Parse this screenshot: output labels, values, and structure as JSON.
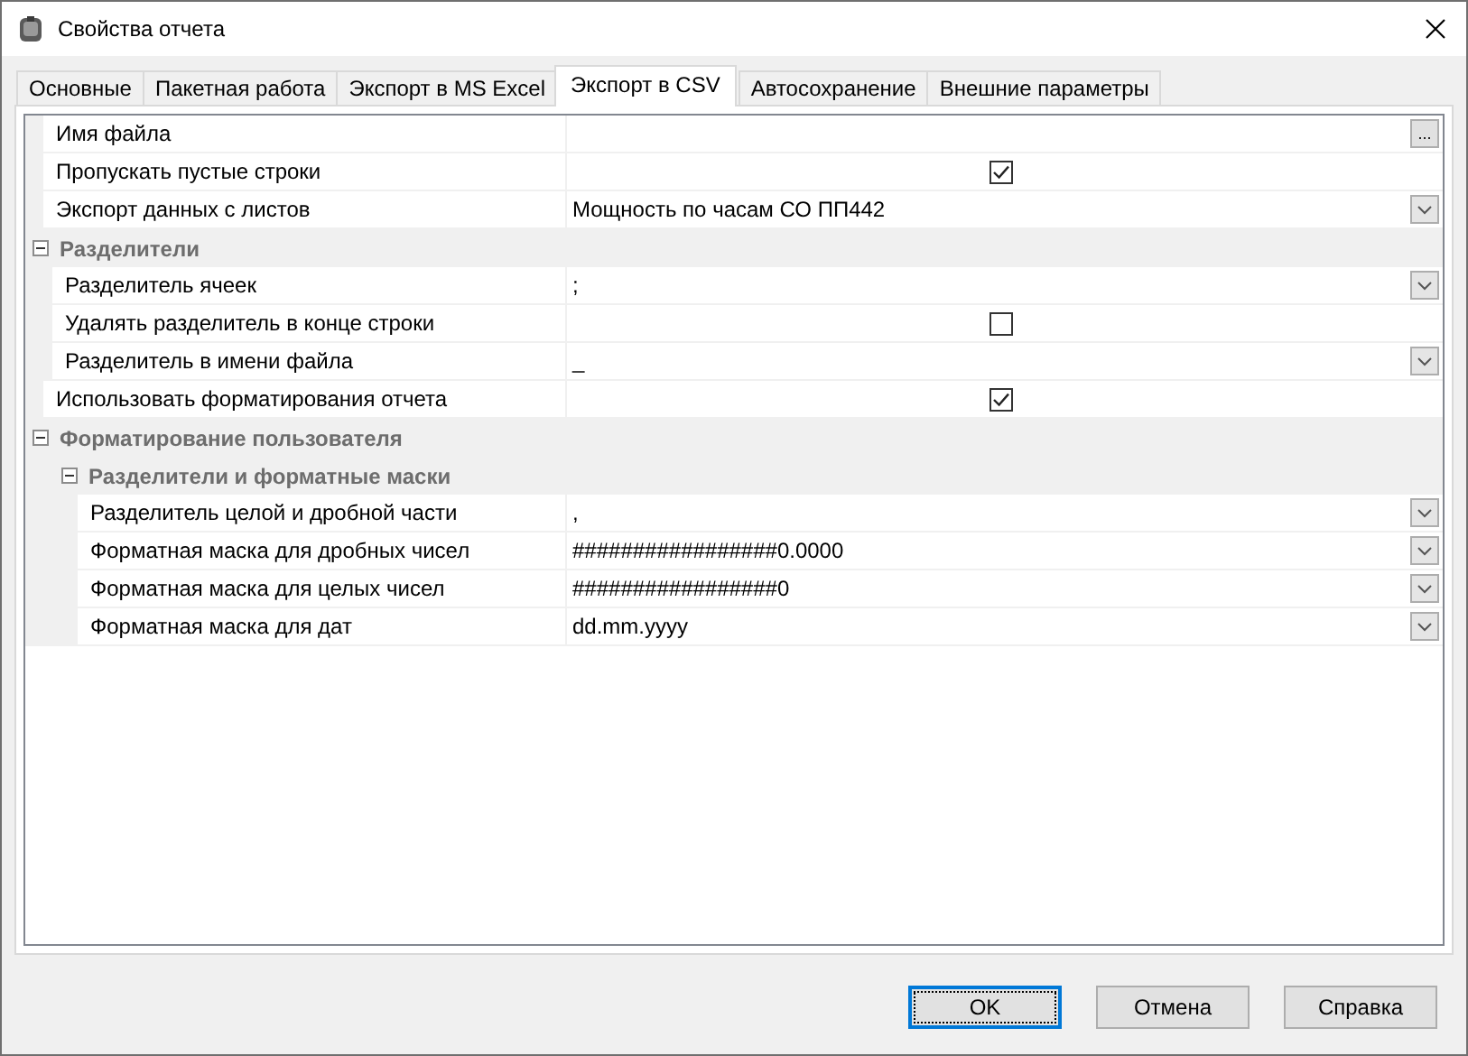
{
  "window": {
    "title": "Свойства отчета"
  },
  "tabs": [
    {
      "label": "Основные",
      "selected": false
    },
    {
      "label": "Пакетная работа",
      "selected": false
    },
    {
      "label": "Экспорт в MS Excel",
      "selected": false
    },
    {
      "label": "Экспорт в CSV",
      "selected": true
    },
    {
      "label": "Автосохранение",
      "selected": false
    },
    {
      "label": "Внешние параметры",
      "selected": false
    }
  ],
  "properties": [
    {
      "kind": "text",
      "label": "Имя файла",
      "button": "..."
    },
    {
      "kind": "checkbox",
      "label": "Пропускать пустые строки",
      "checked": true
    },
    {
      "kind": "combo",
      "label": "Экспорт данных с листов",
      "value": "Мощность по часам СО ПП442"
    },
    {
      "kind": "category",
      "label": "Разделители",
      "expanded": true,
      "children": [
        {
          "kind": "combo",
          "label": "Разделитель ячеек",
          "value": ";"
        },
        {
          "kind": "checkbox",
          "label": "Удалять разделитель в конце строки",
          "checked": false
        },
        {
          "kind": "combo",
          "label": "Разделитель в имени файла",
          "value": "_"
        }
      ]
    },
    {
      "kind": "checkbox",
      "label": "Использовать форматирования отчета",
      "checked": true
    },
    {
      "kind": "category",
      "label": "Форматирование пользователя",
      "expanded": true,
      "children": [
        {
          "kind": "category",
          "label": "Разделители и форматные маски",
          "expanded": true,
          "children": [
            {
              "kind": "combo",
              "label": "Разделитель целой и дробной части",
              "value": ","
            },
            {
              "kind": "combo",
              "label": "Форматная маска для дробных чисел",
              "value": "#################0.0000"
            },
            {
              "kind": "combo",
              "label": "Форматная маска для целых чисел",
              "value": "#################0"
            },
            {
              "kind": "combo",
              "label": "Форматная маска для дат",
              "value": "dd.mm.yyyy"
            }
          ]
        }
      ]
    }
  ],
  "buttons": [
    {
      "label": "OK",
      "focused": true
    },
    {
      "label": "Отмена",
      "focused": false
    },
    {
      "label": "Справка",
      "focused": false
    }
  ]
}
